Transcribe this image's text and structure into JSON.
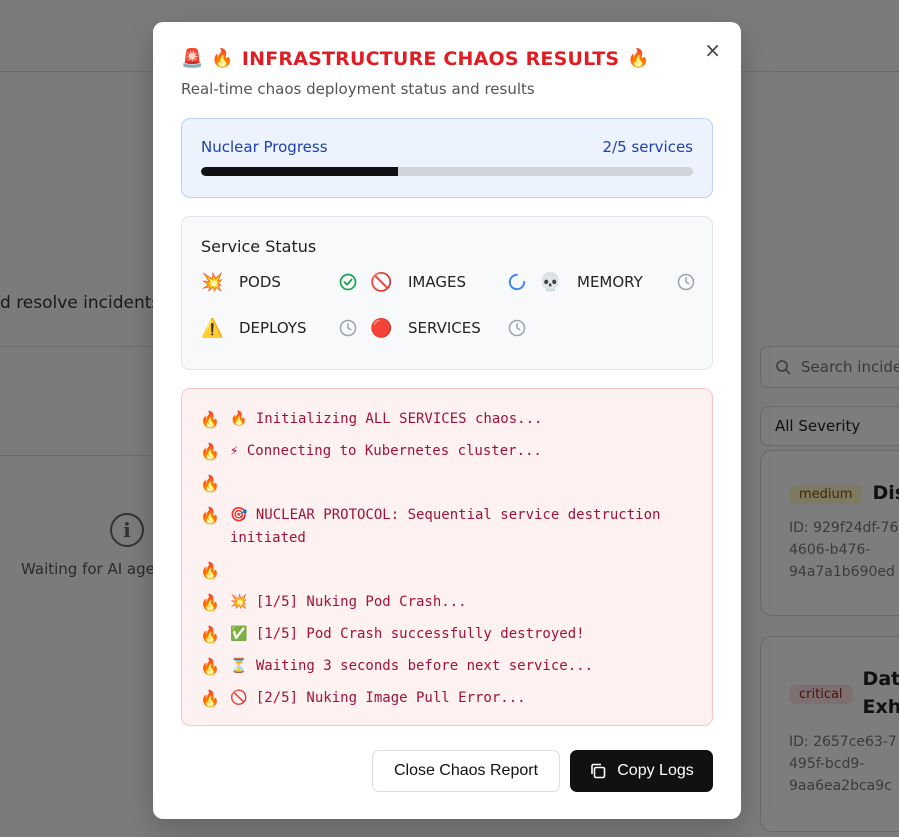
{
  "background": {
    "resolve_text": "d resolve incidents",
    "waiting_text": "Waiting for AI agen",
    "search_placeholder": "Search incide",
    "severity_select": "All Severity",
    "incidents": [
      {
        "severity": "medium",
        "title": "Dis",
        "id": "ID: 929f24df-76\n4606-b476-\n94a7a1b690ed"
      },
      {
        "severity": "critical",
        "title": "Dat\nExh",
        "id": "ID: 2657ce63-7\n495f-bcd9-\n9aa6ea2bca9c"
      }
    ]
  },
  "modal": {
    "close_label": "×",
    "title": "INFRASTRUCTURE CHAOS RESULTS",
    "title_emoji_left": "🚨",
    "title_emoji_fire": "🔥",
    "subtitle": "Real-time chaos deployment status and results",
    "progress": {
      "label": "Nuclear Progress",
      "count_text": "2/5 services",
      "fraction": 0.4
    },
    "service_status": {
      "heading": "Service Status",
      "services": [
        {
          "emoji": "💥",
          "name": "PODS",
          "state": "done"
        },
        {
          "emoji": "🚫",
          "name": "IMAGES",
          "state": "running"
        },
        {
          "emoji": "💀",
          "name": "MEMORY",
          "state": "pending"
        },
        {
          "emoji": "⚠️",
          "name": "DEPLOYS",
          "state": "pending"
        },
        {
          "emoji": "🔴",
          "name": "SERVICES",
          "state": "pending"
        }
      ]
    },
    "logs": [
      "🔥 Initializing ALL SERVICES chaos...",
      "⚡ Connecting to Kubernetes cluster...",
      "",
      "🎯 NUCLEAR PROTOCOL: Sequential service destruction initiated",
      "",
      "💥 [1/5] Nuking Pod Crash...",
      "✅ [1/5] Pod Crash successfully destroyed!",
      "⏳ Waiting 3 seconds before next service...",
      "🚫 [2/5] Nuking Image Pull Error..."
    ],
    "buttons": {
      "close_report": "Close Chaos Report",
      "copy_logs": "Copy Logs"
    },
    "colors": {
      "title_red": "#e11d24",
      "progress_blue": "#1e40af",
      "log_text": "#9f1239",
      "done_green": "#16a34a",
      "running_blue": "#3b82f6",
      "pending_gray": "#9ca3af"
    }
  }
}
